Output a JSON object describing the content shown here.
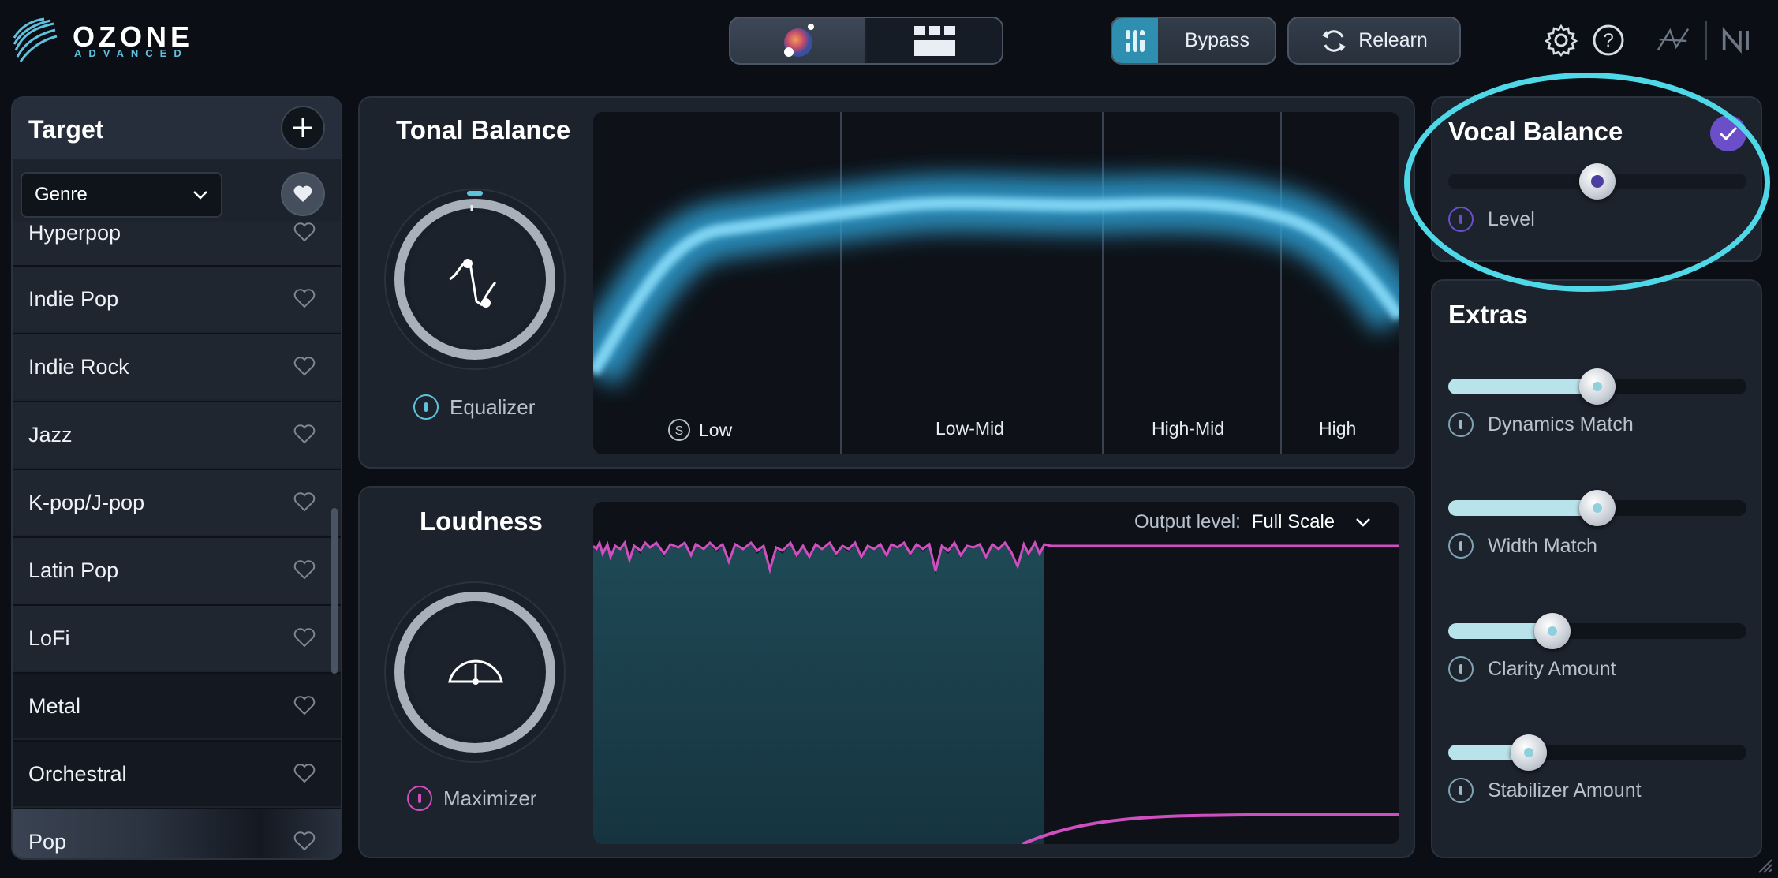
{
  "app": {
    "logo_text": "OZONE",
    "logo_sub": "ADVANCED"
  },
  "toolbar": {
    "bypass_label": "Bypass",
    "relearn_label": "Relearn"
  },
  "target": {
    "title": "Target",
    "dropdown_value": "Genre",
    "items": [
      {
        "label": "Hyperpop"
      },
      {
        "label": "Indie Pop"
      },
      {
        "label": "Indie Rock"
      },
      {
        "label": "Jazz"
      },
      {
        "label": "K-pop/J-pop"
      },
      {
        "label": "Latin Pop"
      },
      {
        "label": "LoFi"
      },
      {
        "label": "Metal"
      },
      {
        "label": "Orchestral"
      },
      {
        "label": "Pop"
      }
    ]
  },
  "tonal": {
    "title": "Tonal Balance",
    "caption": "Equalizer",
    "bands": [
      "Low",
      "Low-Mid",
      "High-Mid",
      "High"
    ],
    "solo_glyph": "S"
  },
  "loudness": {
    "title": "Loudness",
    "caption": "Maximizer",
    "output_label": "Output level:",
    "output_value": "Full Scale"
  },
  "vocal": {
    "title": "Vocal Balance",
    "level_label": "Level",
    "level_value": 0.5
  },
  "extras": {
    "title": "Extras",
    "sliders": [
      {
        "label": "Dynamics Match",
        "value": 0.5
      },
      {
        "label": "Width Match",
        "value": 0.5
      },
      {
        "label": "Clarity Amount",
        "value": 0.35
      },
      {
        "label": "Stabilizer Amount",
        "value": 0.27
      }
    ]
  },
  "colors": {
    "accent": "#5fc1de",
    "loudness_line": "#d04fc0",
    "highlight": "#4fd8e8",
    "vocal_check": "#6a4fc9"
  }
}
